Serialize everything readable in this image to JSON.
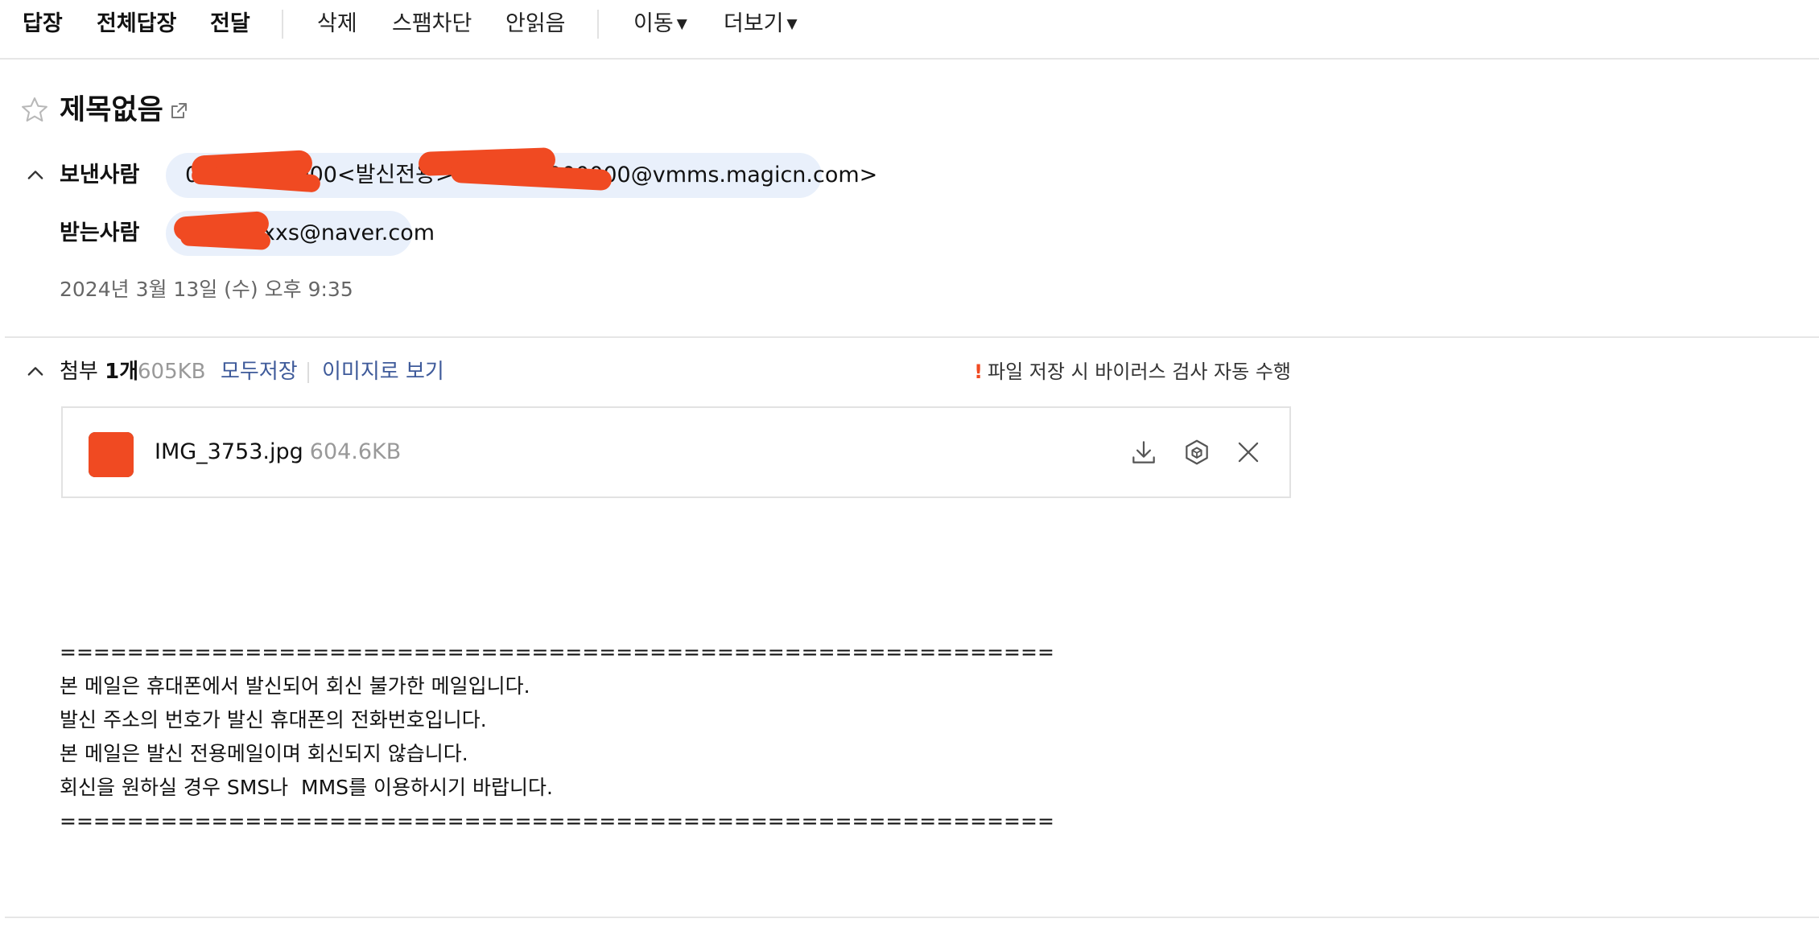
{
  "toolbar": {
    "reply": "답장",
    "reply_all": "전체답장",
    "forward": "전달",
    "delete": "삭제",
    "block_spam": "스팸차단",
    "mark_unread": "안읽음",
    "move": "이동",
    "more": "더보기"
  },
  "header": {
    "subject": "제목없음",
    "from_label": "보낸사람",
    "from_value": "01000000000<발신전용> <01000000000@vmms.magicn.com>",
    "to_label": "받는사람",
    "to_value": "xxxxxxxxs@naver.com",
    "date": "2024년 3월 13일 (수) 오후 9:35"
  },
  "attachments": {
    "label": "첨부",
    "count": "1개",
    "total_size": "605KB",
    "save_all": "모두저장",
    "view_as_image": "이미지로 보기",
    "virus_note": "파일 저장 시 바이러스 검사 자동 수행",
    "files": [
      {
        "name": "IMG_3753.jpg",
        "size": "604.6KB"
      }
    ]
  },
  "body": {
    "text": "===========================================================\n본 메일은 휴대폰에서 발신되어 회신 불가한 메일입니다.\n발신 주소의 번호가 발신 휴대폰의 전화번호입니다.\n본 메일은 발신 전용메일이며 회신되지 않습니다.\n회신을 원하실 경우 SMS나  MMS를 이용하시기 바랍니다.\n==========================================================="
  },
  "colors": {
    "accent_link": "#3e5a9a",
    "chip_bg": "#e9f0fb",
    "warning": "#f04a22"
  },
  "icons": [
    "star-icon",
    "popout-icon",
    "chevron-up-icon",
    "download-icon",
    "cube-icon",
    "close-icon",
    "caret-down-icon"
  ]
}
